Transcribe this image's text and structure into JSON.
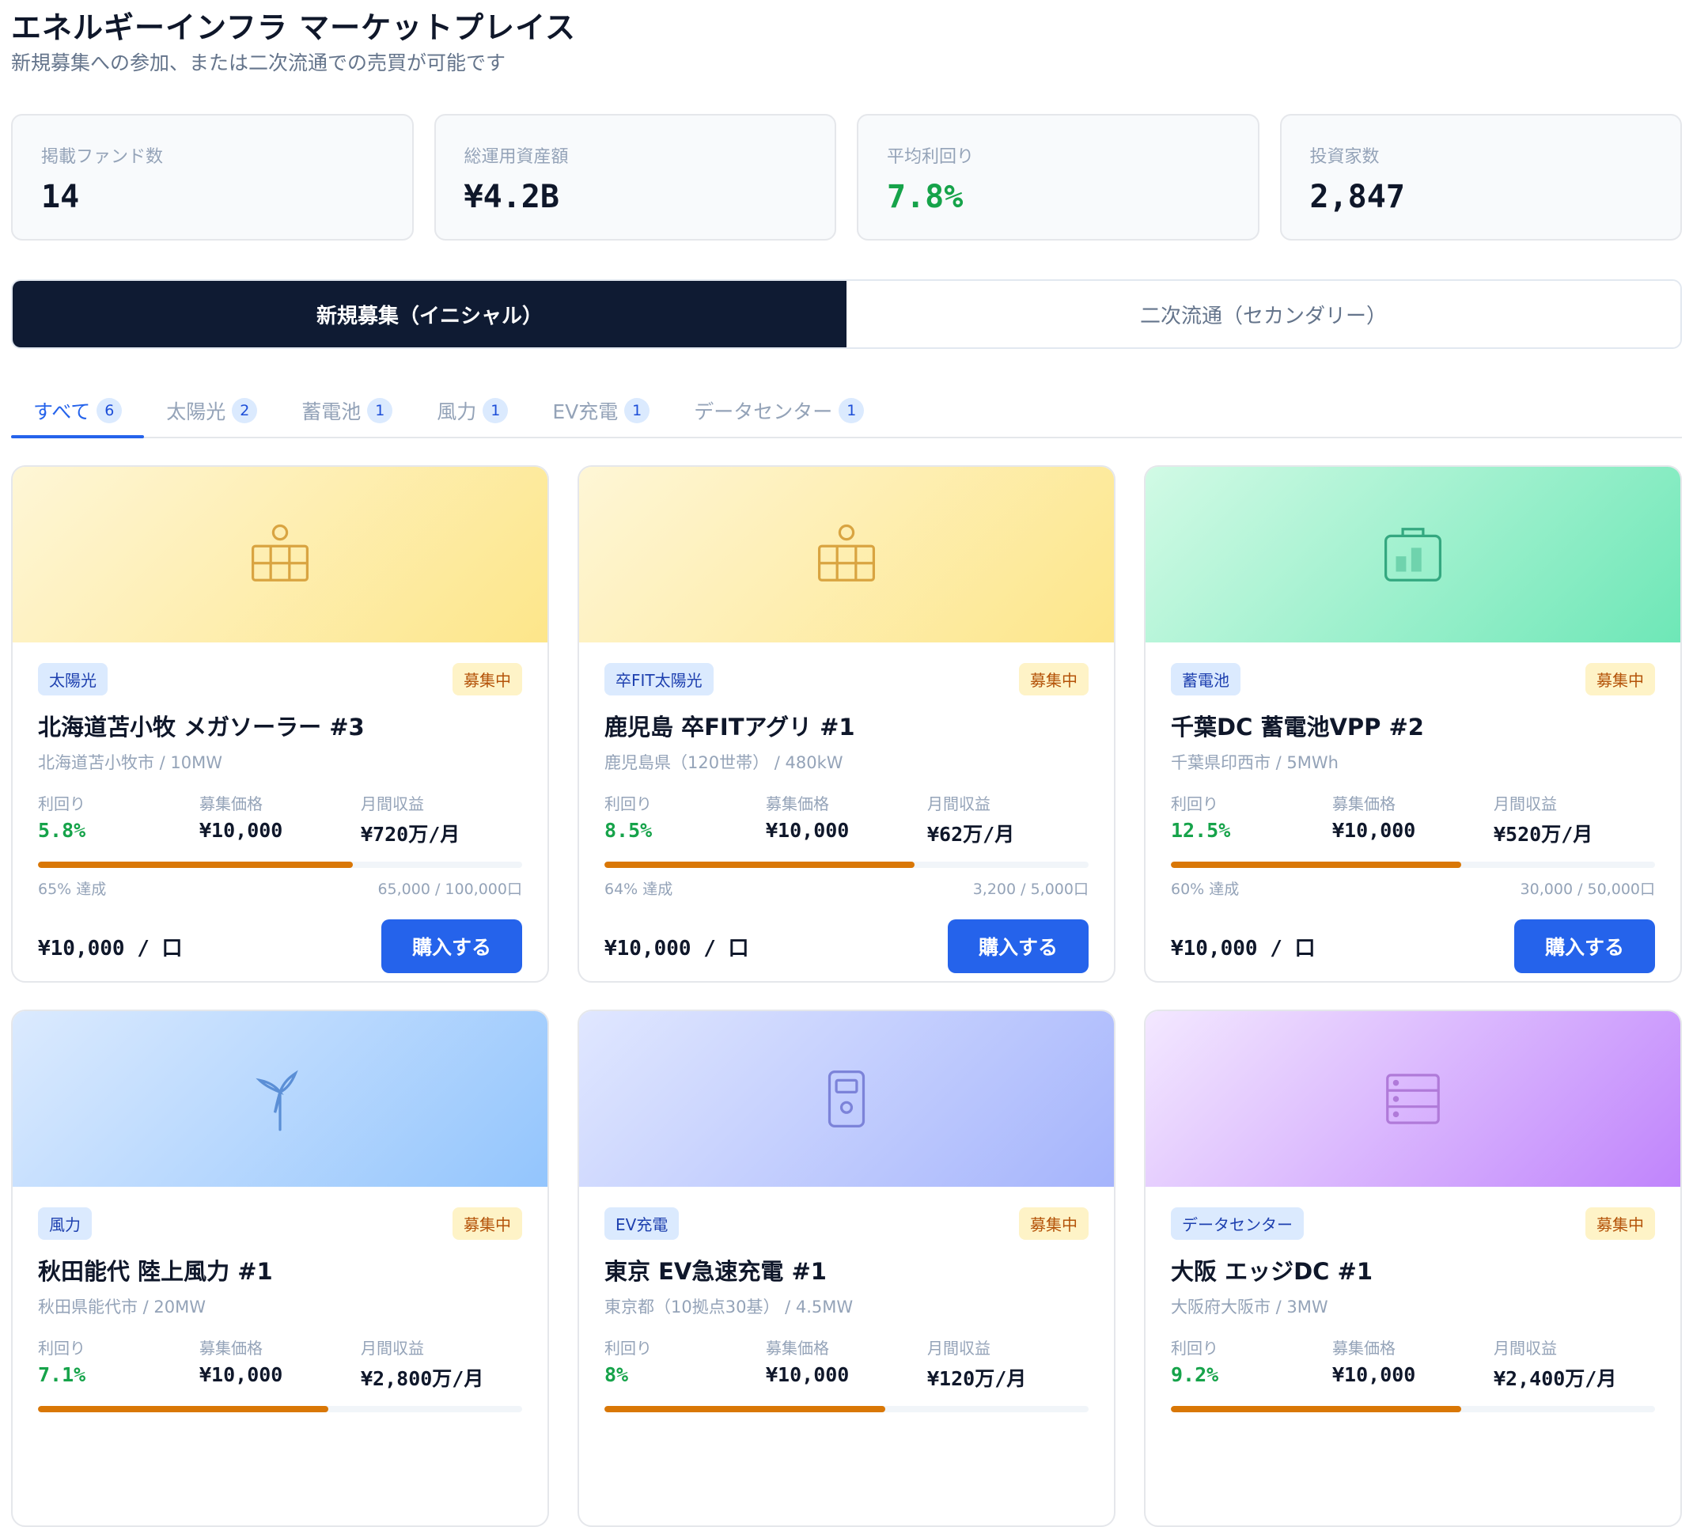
{
  "header": {
    "title": "エネルギーインフラ マーケットプレイス",
    "subtitle": "新規募集への参加、または二次流通での売買が可能です"
  },
  "stats": [
    {
      "label": "掲載ファンド数",
      "value": "14"
    },
    {
      "label": "総運用資産額",
      "value": "¥4.2B"
    },
    {
      "label": "平均利回り",
      "value": "7.8%"
    },
    {
      "label": "投資家数",
      "value": "2,847"
    }
  ],
  "mode_tabs": [
    {
      "label": "新規募集（イニシャル）",
      "active": true
    },
    {
      "label": "二次流通（セカンダリー）",
      "active": false
    }
  ],
  "category_tabs": [
    {
      "label": "すべて",
      "count": "6",
      "active": true
    },
    {
      "label": "太陽光",
      "count": "2"
    },
    {
      "label": "蓄電池",
      "count": "1"
    },
    {
      "label": "風力",
      "count": "1"
    },
    {
      "label": "EV充電",
      "count": "1"
    },
    {
      "label": "データセンター",
      "count": "1"
    }
  ],
  "labels": {
    "yield": "利回り",
    "offer_price": "募集価格",
    "monthly_income": "月間収益",
    "buy": "購入する"
  },
  "cards": [
    {
      "icon": "solar-panel-icon",
      "theme": "solar",
      "type": "太陽光",
      "status": "募集中",
      "name": "北海道苫小牧 メガソーラー #3",
      "location": "北海道苫小牧市 / 10MW",
      "yield": "5.8%",
      "price": "¥10,000",
      "monthly": "¥720万/月",
      "progress": 65,
      "progress_label": "65% 達成",
      "units": "65,000 / 100,000口",
      "unit_price": "¥10,000 / 口"
    },
    {
      "icon": "solar-panel-icon",
      "theme": "solar",
      "type": "卒FIT太陽光",
      "status": "募集中",
      "name": "鹿児島 卒FITアグリ #1",
      "location": "鹿児島県（120世帯） / 480kW",
      "yield": "8.5%",
      "price": "¥10,000",
      "monthly": "¥62万/月",
      "progress": 64,
      "progress_label": "64% 達成",
      "units": "3,200 / 5,000口",
      "unit_price": "¥10,000 / 口"
    },
    {
      "icon": "battery-icon",
      "theme": "battery",
      "type": "蓄電池",
      "status": "募集中",
      "name": "千葉DC 蓄電池VPP #2",
      "location": "千葉県印西市 / 5MWh",
      "yield": "12.5%",
      "price": "¥10,000",
      "monthly": "¥520万/月",
      "progress": 60,
      "progress_label": "60% 達成",
      "units": "30,000 / 50,000口",
      "unit_price": "¥10,000 / 口"
    },
    {
      "icon": "wind-turbine-icon",
      "theme": "wind",
      "type": "風力",
      "status": "募集中",
      "name": "秋田能代 陸上風力 #1",
      "location": "秋田県能代市 / 20MW",
      "yield": "7.1%",
      "price": "¥10,000",
      "monthly": "¥2,800万/月",
      "progress": 60,
      "progress_label": "",
      "units": "",
      "unit_price": ""
    },
    {
      "icon": "ev-charger-icon",
      "theme": "ev",
      "type": "EV充電",
      "status": "募集中",
      "name": "東京 EV急速充電 #1",
      "location": "東京都（10拠点30基） / 4.5MW",
      "yield": "8%",
      "price": "¥10,000",
      "monthly": "¥120万/月",
      "progress": 58,
      "progress_label": "",
      "units": "",
      "unit_price": ""
    },
    {
      "icon": "server-rack-icon",
      "theme": "dc",
      "type": "データセンター",
      "status": "募集中",
      "name": "大阪 エッジDC #1",
      "location": "大阪府大阪市 / 3MW",
      "yield": "9.2%",
      "price": "¥10,000",
      "monthly": "¥2,400万/月",
      "progress": 60,
      "progress_label": "",
      "units": "",
      "unit_price": ""
    }
  ],
  "colors": {
    "accent": "#2563eb",
    "dark_tab": "#0f1b33",
    "progress": "#d97706",
    "yield_green": "#16a34a"
  }
}
